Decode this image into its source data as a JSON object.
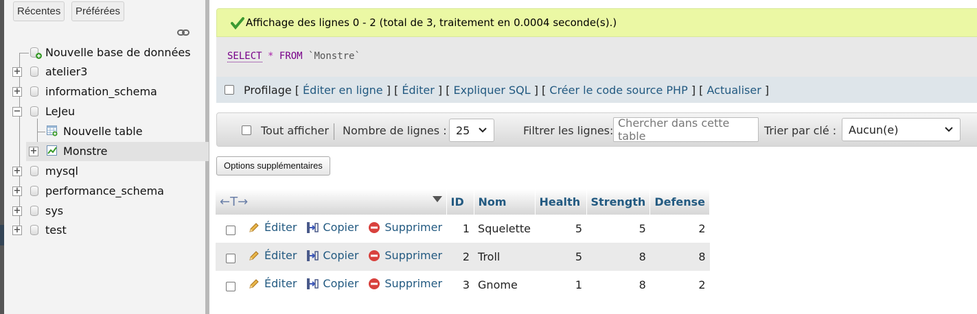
{
  "sidebar": {
    "tabs": {
      "recent": "Récentes",
      "favorites": "Préférées"
    },
    "tree": [
      {
        "label": "Nouvelle base de données",
        "type": "new-db"
      },
      {
        "label": "atelier3",
        "type": "db"
      },
      {
        "label": "information_schema",
        "type": "db"
      },
      {
        "label": "LeJeu",
        "type": "db-expanded"
      },
      {
        "label": "Nouvelle table",
        "type": "new-table"
      },
      {
        "label": "Monstre",
        "type": "table-selected"
      },
      {
        "label": "mysql",
        "type": "db"
      },
      {
        "label": "performance_schema",
        "type": "db"
      },
      {
        "label": "sys",
        "type": "db"
      },
      {
        "label": "test",
        "type": "db"
      }
    ]
  },
  "message": {
    "success": "Affichage des lignes 0 - 2 (total de 3, traitement en 0.0004 seconde(s).)"
  },
  "sql": {
    "select": "SELECT",
    "star": "*",
    "from": "FROM",
    "table": "`Monstre`"
  },
  "profile": {
    "label": "Profilage",
    "links": [
      "Éditer en ligne",
      "Éditer",
      "Expliquer SQL",
      "Créer le code source PHP",
      "Actualiser"
    ]
  },
  "navigation": {
    "show_all": "Tout afficher",
    "rows_label": "Nombre de lignes :",
    "rows_value": "25",
    "filter_label": "Filtrer les lignes:",
    "filter_placeholder": "Chercher dans cette table",
    "sort_label": "Trier par clé :",
    "sort_value": "Aucun(e)"
  },
  "options_button": "Options supplémentaires",
  "table": {
    "arrows": "←T→",
    "columns": [
      "ID",
      "Nom",
      "Health",
      "Strength",
      "Defense"
    ],
    "actions": {
      "edit": "Éditer",
      "copy": "Copier",
      "delete": "Supprimer"
    },
    "rows": [
      {
        "id": "1",
        "nom": "Squelette",
        "health": "5",
        "strength": "5",
        "defense": "2"
      },
      {
        "id": "2",
        "nom": "Troll",
        "health": "5",
        "strength": "8",
        "defense": "8"
      },
      {
        "id": "3",
        "nom": "Gnome",
        "health": "1",
        "strength": "8",
        "defense": "2"
      }
    ]
  },
  "colors": {
    "link": "#235a81",
    "success_bg": "#ebf8a4",
    "sql_keyword": "#770088"
  }
}
